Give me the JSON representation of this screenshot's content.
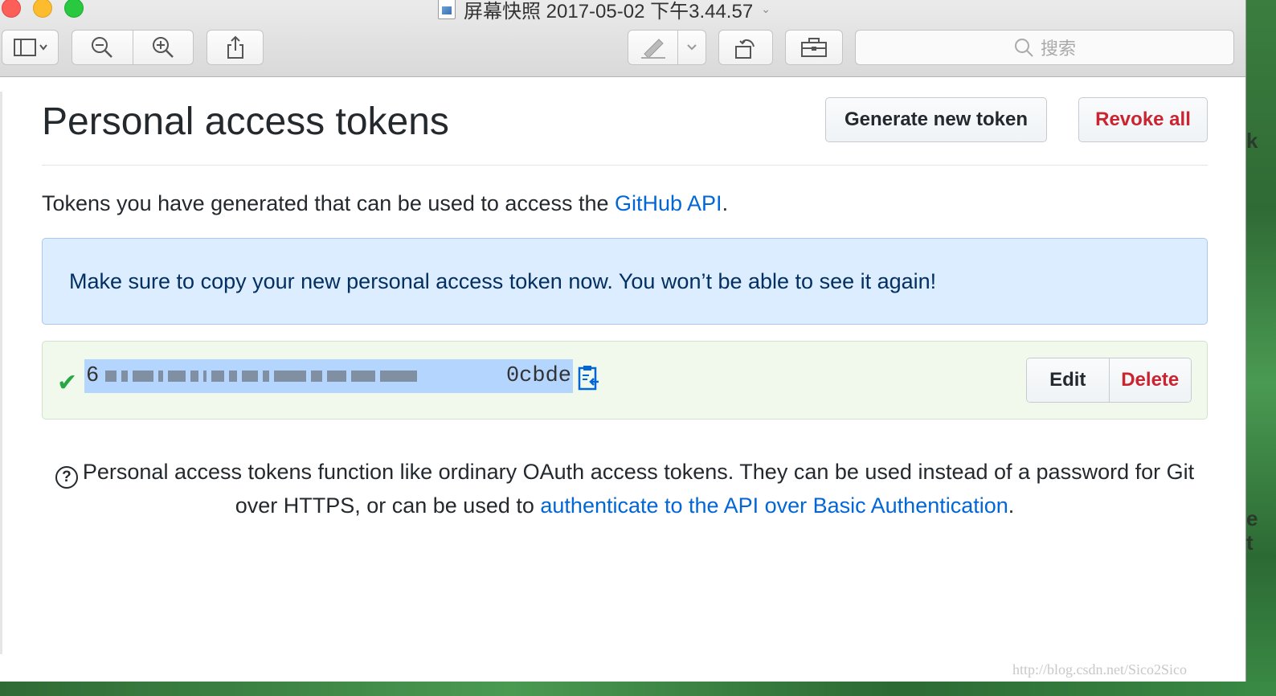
{
  "window": {
    "title": "屏幕快照 2017-05-02 下午3.44.57",
    "search_placeholder": "搜索"
  },
  "page": {
    "title": "Personal access tokens",
    "generate_button": "Generate new token",
    "revoke_button": "Revoke all",
    "intro_text": "Tokens you have generated that can be used to access the ",
    "intro_link": "GitHub API",
    "intro_end": ".",
    "flash_message": "Make sure to copy your new personal access token now. You won’t be able to see it again!",
    "token": {
      "prefix": "6",
      "suffix": "0cbde",
      "edit_label": "Edit",
      "delete_label": "Delete"
    },
    "note_text": "Personal access tokens function like ordinary OAuth access tokens. They can be used instead of a password for Git over HTTPS, or can be used to ",
    "note_link": "authenticate to the API over Basic Authentication",
    "note_end": "."
  },
  "watermark": "http://blog.csdn.net/Sico2Sico",
  "colors": {
    "link": "#0366d6",
    "danger": "#cb2431",
    "success": "#28a745",
    "flash_bg": "#dbedff"
  }
}
